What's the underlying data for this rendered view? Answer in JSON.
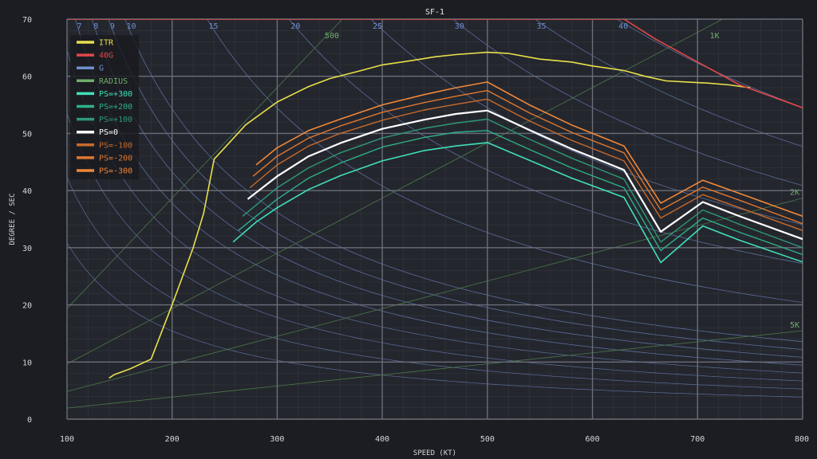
{
  "chart_data": {
    "type": "line",
    "title": "SF-1",
    "xlabel": "SPEED (KT)",
    "ylabel": "DEGREE / SEC",
    "xlim": [
      100,
      800
    ],
    "ylim": [
      0,
      70
    ],
    "x_ticks": [
      100,
      200,
      300,
      400,
      500,
      600,
      700,
      800
    ],
    "y_ticks": [
      0,
      10,
      20,
      30,
      40,
      50,
      60,
      70
    ],
    "grid": true,
    "legend_placement": "top-left",
    "g_lines": [
      {
        "g": 7,
        "label": "7"
      },
      {
        "g": 8,
        "label": "8"
      },
      {
        "g": 9,
        "label": "9"
      },
      {
        "g": 10,
        "label": "10"
      },
      {
        "g": 15,
        "label": "15"
      },
      {
        "g": 20,
        "label": "20"
      },
      {
        "g": 25,
        "label": "25"
      },
      {
        "g": 30,
        "label": "30"
      },
      {
        "g": 35,
        "label": "35"
      },
      {
        "g": 40,
        "label": "40"
      }
    ],
    "radius_lines": [
      {
        "r": 500,
        "label": "500"
      },
      {
        "r": 1000,
        "label": "1K"
      },
      {
        "r": 2000,
        "label": "2K"
      },
      {
        "r": 5000,
        "label": "5K"
      }
    ],
    "series": [
      {
        "name": "ITR",
        "color": "#e8e04a",
        "width": 1.6,
        "x": [
          140,
          145,
          160,
          180,
          200,
          220,
          230,
          240,
          250,
          270,
          300,
          330,
          350,
          380,
          400,
          430,
          450,
          470,
          500,
          520,
          550,
          580,
          600,
          630,
          650,
          670,
          690,
          710,
          730,
          750
        ],
        "y": [
          7.2,
          7.8,
          8.8,
          10.5,
          20,
          30,
          36,
          45.5,
          47.5,
          51.5,
          55.5,
          58.2,
          59.6,
          61.0,
          62.0,
          62.8,
          63.4,
          63.8,
          64.2,
          64.0,
          63.0,
          62.5,
          61.8,
          61.0,
          60.0,
          59.2,
          59.0,
          58.8,
          58.5,
          58.0
        ]
      },
      {
        "name": "40G",
        "color": "#e04848",
        "width": 1.6,
        "x": [
          100,
          160,
          630,
          660,
          700,
          740,
          800
        ],
        "y": [
          70,
          70,
          70,
          66.5,
          62.5,
          58.5,
          54.5
        ]
      },
      {
        "name": "PS=-300",
        "color": "#f08838",
        "width": 1.6,
        "x": [
          280,
          300,
          330,
          360,
          400,
          440,
          470,
          500,
          540,
          580,
          630,
          665,
          705,
          740,
          800
        ],
        "y": [
          44.5,
          47.5,
          50.5,
          52.5,
          55.0,
          56.8,
          58.0,
          59.0,
          55.0,
          51.5,
          47.8,
          37.8,
          41.8,
          39.5,
          35.5
        ]
      },
      {
        "name": "PS=-200",
        "color": "#e0782e",
        "width": 1.4,
        "x": [
          277,
          300,
          330,
          360,
          400,
          440,
          470,
          500,
          540,
          580,
          630,
          665,
          705,
          740,
          800
        ],
        "y": [
          42.5,
          46.0,
          49.2,
          51.3,
          53.7,
          55.4,
          56.5,
          57.5,
          53.6,
          50.2,
          46.6,
          36.6,
          40.6,
          38.3,
          34.2
        ]
      },
      {
        "name": "PS=-100",
        "color": "#c86a2a",
        "width": 1.4,
        "x": [
          274,
          300,
          330,
          360,
          400,
          440,
          470,
          500,
          540,
          580,
          630,
          665,
          705,
          740,
          800
        ],
        "y": [
          40.5,
          44.5,
          47.8,
          50.0,
          52.3,
          54.1,
          55.1,
          56.0,
          52.2,
          48.8,
          45.2,
          35.2,
          39.3,
          37.0,
          33.0
        ]
      },
      {
        "name": "PS=0",
        "color": "#ffffff",
        "width": 2.2,
        "x": [
          272,
          300,
          330,
          360,
          400,
          440,
          470,
          500,
          540,
          580,
          630,
          665,
          705,
          740,
          800
        ],
        "y": [
          38.5,
          42.5,
          46.0,
          48.3,
          50.8,
          52.4,
          53.4,
          54.0,
          50.6,
          47.3,
          43.6,
          32.8,
          38.0,
          35.5,
          31.5
        ]
      },
      {
        "name": "PS=+100",
        "color": "#2e9878",
        "width": 1.4,
        "x": [
          267,
          300,
          330,
          360,
          400,
          440,
          470,
          500,
          540,
          580,
          630,
          665,
          705,
          740,
          800
        ],
        "y": [
          35.5,
          40.5,
          44.0,
          46.6,
          49.2,
          50.9,
          51.8,
          52.5,
          49.0,
          45.7,
          42.0,
          31.0,
          36.6,
          34.1,
          30.0
        ]
      },
      {
        "name": "PS=+200",
        "color": "#2eb088",
        "width": 1.4,
        "x": [
          263,
          300,
          330,
          360,
          400,
          440,
          470,
          500,
          540,
          580,
          630,
          665,
          705,
          740,
          800
        ],
        "y": [
          33.0,
          38.5,
          42.2,
          44.8,
          47.6,
          49.3,
          50.2,
          50.5,
          47.2,
          44.0,
          40.5,
          29.5,
          35.2,
          32.7,
          28.8
        ]
      },
      {
        "name": "PS=+300",
        "color": "#3fe0b8",
        "width": 1.6,
        "x": [
          258,
          280,
          300,
          330,
          360,
          400,
          440,
          470,
          500,
          540,
          580,
          630,
          665,
          705,
          740,
          800
        ],
        "y": [
          31.0,
          34.5,
          37.0,
          40.2,
          42.6,
          45.2,
          47.0,
          47.8,
          48.4,
          45.3,
          42.2,
          38.8,
          27.4,
          33.8,
          31.3,
          27.5
        ]
      }
    ],
    "legend": [
      {
        "label": "ITR",
        "color": "#e8e04a"
      },
      {
        "label": "40G",
        "color": "#e04848"
      },
      {
        "label": "G",
        "color": "#6f8fcf"
      },
      {
        "label": "RADIUS",
        "color": "#6fae6a"
      },
      {
        "label": "PS=+300",
        "color": "#3fe0b8"
      },
      {
        "label": "PS=+200",
        "color": "#2eb088"
      },
      {
        "label": "PS=+100",
        "color": "#2e9878"
      },
      {
        "label": "PS=0",
        "color": "#ffffff"
      },
      {
        "label": "PS=-100",
        "color": "#c86a2a"
      },
      {
        "label": "PS=-200",
        "color": "#e0782e"
      },
      {
        "label": "PS=-300",
        "color": "#f08838"
      }
    ],
    "colors": {
      "background": "#1c1d22",
      "plot_background": "#24262e",
      "major_grid": "#6a6e78",
      "minor_grid": "#34373f",
      "g_line": "#5a6e9a",
      "radius_line": "#4a7a48"
    }
  }
}
